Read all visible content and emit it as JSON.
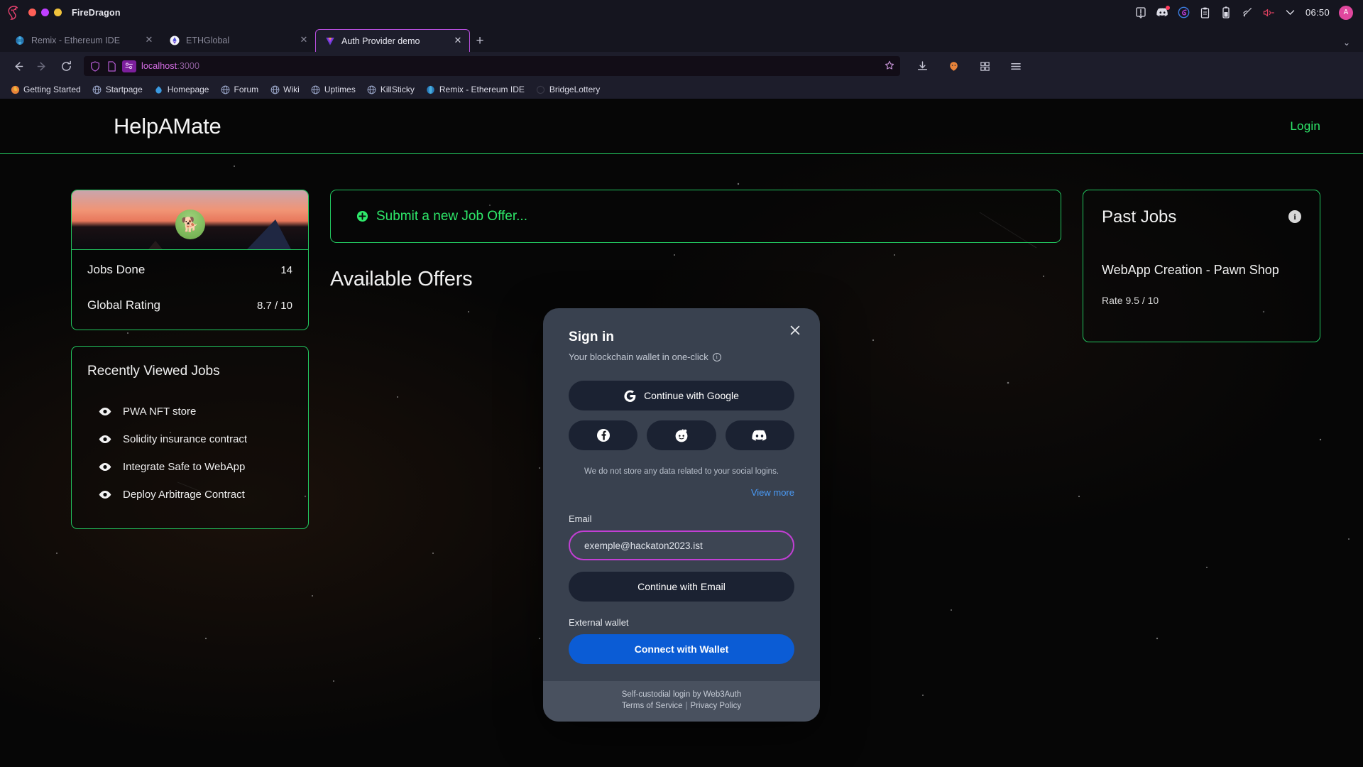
{
  "browser": {
    "app_name": "FireDragon",
    "window_dots": [
      "close",
      "minimize",
      "maximize"
    ],
    "tabs": [
      {
        "title": "Remix - Ethereum IDE",
        "favicon": "remix-icon",
        "active": false
      },
      {
        "title": "ETHGlobal",
        "favicon": "ethglobal-icon",
        "active": false
      },
      {
        "title": "Auth Provider demo",
        "favicon": "web3auth-icon",
        "active": true
      }
    ],
    "new_tab_label": "+",
    "tabs_list_chevron": "chevron-down",
    "nav": {
      "back": "back-arrow",
      "forward": "forward-arrow",
      "reload": "reload-icon"
    },
    "url": {
      "host": "localhost",
      "port": ":3000",
      "shield": "shield-icon",
      "page": "page-icon",
      "reader": "reader-chip",
      "star": "star-icon"
    },
    "toolbar_right": [
      "download-icon",
      "extension-fox-icon",
      "extensions-icon",
      "menu-icon"
    ],
    "bookmarks": [
      {
        "label": "Getting Started",
        "icon": "firefox-icon"
      },
      {
        "label": "Startpage",
        "icon": "globe-icon"
      },
      {
        "label": "Homepage",
        "icon": "water-drop-icon"
      },
      {
        "label": "Forum",
        "icon": "globe-icon"
      },
      {
        "label": "Wiki",
        "icon": "globe-icon"
      },
      {
        "label": "Uptimes",
        "icon": "globe-icon"
      },
      {
        "label": "KillSticky",
        "icon": "globe-icon"
      },
      {
        "label": "Remix - Ethereum IDE",
        "icon": "remix-icon"
      },
      {
        "label": "BridgeLottery",
        "icon": "blank-icon"
      }
    ],
    "tray": {
      "icons": [
        "alert-icon",
        "discord-icon",
        "sync-icon",
        "clipboard-icon",
        "battery-icon",
        "wifi-icon",
        "volume-icon",
        "chevron-down-icon"
      ],
      "time": "06:50",
      "avatar_initial": "A"
    }
  },
  "site": {
    "brand": "HelpAMate",
    "login_label": "Login",
    "accent_green": "#22c55e",
    "profile": {
      "avatar": "dog-avatar",
      "stats": [
        {
          "label": "Jobs Done",
          "value": "14"
        },
        {
          "label": "Global Rating",
          "value": "8.7 / 10"
        }
      ]
    },
    "recent": {
      "title": "Recently Viewed Jobs",
      "items": [
        {
          "label": "PWA NFT store",
          "icon": "eye-icon"
        },
        {
          "label": "Solidity insurance contract",
          "icon": "eye-icon"
        },
        {
          "label": "Integrate Safe to WebApp",
          "icon": "eye-icon"
        },
        {
          "label": "Deploy Arbitrage Contract",
          "icon": "eye-icon"
        }
      ]
    },
    "center": {
      "submit_label": "Submit a new Job Offer...",
      "submit_icon": "plus-circle-icon",
      "available_title": "Available Offers"
    },
    "past_jobs": {
      "title": "Past Jobs",
      "info_icon": "info-icon",
      "job_title": "WebApp Creation - Pawn Shop",
      "rate": "Rate 9.5 / 10"
    }
  },
  "modal": {
    "close_icon": "close-icon",
    "title": "Sign in",
    "subtitle": "Your blockchain wallet in one-click",
    "subtitle_info_icon": "info-icon",
    "google_button": {
      "label": "Continue with Google",
      "icon": "google-icon"
    },
    "social_buttons": [
      {
        "name": "facebook",
        "icon": "facebook-icon"
      },
      {
        "name": "reddit",
        "icon": "reddit-icon"
      },
      {
        "name": "discord",
        "icon": "discord-icon"
      }
    ],
    "fineprint": "We do not store any data related to your social logins.",
    "view_more": "View more",
    "email_label": "Email",
    "email_value": "exemple@hackaton2023.ist",
    "email_placeholder": "Email",
    "email_button": "Continue with Email",
    "wallet_label": "External wallet",
    "wallet_button": "Connect with Wallet",
    "footer_line1": "Self-custodial login by Web3Auth",
    "footer_terms": "Terms of Service",
    "footer_sep": "|",
    "footer_privacy": "Privacy Policy",
    "accent_blue": "#0b5cd5",
    "border_magenta": "#c23fd4"
  }
}
